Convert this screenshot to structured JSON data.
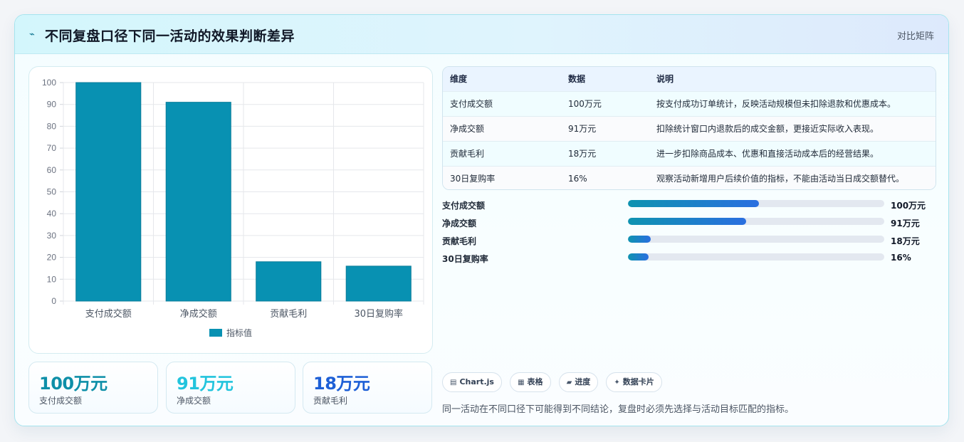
{
  "header": {
    "title": "不同复盘口径下同一活动的效果判断差异",
    "tag": "对比矩阵"
  },
  "chart_data": {
    "type": "bar",
    "categories": [
      "支付成交额",
      "净成交额",
      "贡献毛利",
      "30日复购率"
    ],
    "series": [
      {
        "name": "指标值",
        "values": [
          100,
          91,
          18,
          16
        ]
      }
    ],
    "ylim": [
      0,
      100
    ],
    "yticks": [
      0,
      10,
      20,
      30,
      40,
      50,
      60,
      70,
      80,
      90,
      100
    ],
    "legend": "bottom",
    "grid": true,
    "bar_color": "#0891b2"
  },
  "kpis": [
    {
      "value": "100万元",
      "label": "支付成交额",
      "color": "#0e8fa8"
    },
    {
      "value": "91万元",
      "label": "净成交额",
      "color": "#22c4dd"
    },
    {
      "value": "18万元",
      "label": "贡献毛利",
      "color": "#1d5fd6"
    }
  ],
  "table": {
    "headers": [
      "维度",
      "数据",
      "说明"
    ],
    "rows": [
      [
        "支付成交额",
        "100万元",
        "按支付成功订单统计，反映活动规模但未扣除退款和优惠成本。"
      ],
      [
        "净成交额",
        "91万元",
        "扣除统计窗口内退款后的成交金额，更接近实际收入表现。"
      ],
      [
        "贡献毛利",
        "18万元",
        "进一步扣除商品成本、优惠和直接活动成本后的经营结果。"
      ],
      [
        "30日复购率",
        "16%",
        "观察活动新增用户后续价值的指标，不能由活动当日成交额替代。"
      ]
    ]
  },
  "progress": [
    {
      "label": "支付成交额",
      "value": "100万元",
      "fraction": 0.51
    },
    {
      "label": "净成交额",
      "value": "91万元",
      "fraction": 0.46
    },
    {
      "label": "贡献毛利",
      "value": "18万元",
      "fraction": 0.09
    },
    {
      "label": "30日复购率",
      "value": "16%",
      "fraction": 0.08
    }
  ],
  "chips": [
    {
      "icon": "chart-icon",
      "label": "Chart.js"
    },
    {
      "icon": "table-icon",
      "label": "表格"
    },
    {
      "icon": "progress-icon",
      "label": "进度"
    },
    {
      "icon": "sparkle-icon",
      "label": "数据卡片"
    }
  ],
  "footnote": "同一活动在不同口径下可能得到不同结论，复盘时必须先选择与活动目标匹配的指标。"
}
